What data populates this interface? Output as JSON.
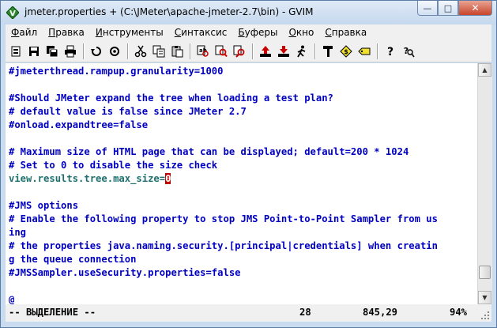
{
  "window": {
    "title": "jmeter.properties + (C:\\JMeter\\apache-jmeter-2.7\\bin) - GVIM",
    "minimize_glyph": "—",
    "maximize_glyph": "□",
    "close_glyph": "✕"
  },
  "menu": {
    "items": [
      {
        "first": "Ф",
        "rest": "айл"
      },
      {
        "first": "П",
        "rest": "равка"
      },
      {
        "first": "И",
        "rest": "нструменты"
      },
      {
        "first": "С",
        "rest": "интаксис"
      },
      {
        "first": "Б",
        "rest": "уферы"
      },
      {
        "first": "О",
        "rest": "кно"
      },
      {
        "first": "С",
        "rest": "правка"
      }
    ]
  },
  "toolbar": {
    "icons": [
      "open-icon",
      "save-icon",
      "save-all-icon",
      "print-icon",
      "undo-icon",
      "redo-icon",
      "cut-icon",
      "copy-icon",
      "paste-icon",
      "find-replace-icon",
      "find-next-icon",
      "find-prev-icon",
      "load-session-icon",
      "save-session-icon",
      "run-script-icon",
      "make-icon",
      "shell-icon",
      "tags-icon",
      "help-icon",
      "find-help-icon"
    ]
  },
  "editor": {
    "lines": [
      {
        "type": "comment",
        "text": "#jmeterthread.rampup.granularity=1000"
      },
      {
        "type": "blank",
        "text": ""
      },
      {
        "type": "comment",
        "text": "#Should JMeter expand the tree when loading a test plan?"
      },
      {
        "type": "comment",
        "text": "# default value is false since JMeter 2.7"
      },
      {
        "type": "comment",
        "text": "#onload.expandtree=false"
      },
      {
        "type": "blank",
        "text": ""
      },
      {
        "type": "comment",
        "text": "# Maximum size of HTML page that can be displayed; default=200 * 1024"
      },
      {
        "type": "comment",
        "text": "# Set to 0 to disable the size check"
      },
      {
        "type": "code",
        "key": "view.results.tree.max_size=",
        "value": "0"
      },
      {
        "type": "blank",
        "text": ""
      },
      {
        "type": "comment",
        "text": "#JMS options"
      },
      {
        "type": "comment",
        "text": "# Enable the following property to stop JMS Point-to-Point Sampler from us"
      },
      {
        "type": "comment",
        "text": "ing"
      },
      {
        "type": "comment",
        "text": "# the properties java.naming.security.[principal|credentials] when creatin"
      },
      {
        "type": "comment",
        "text": "g the queue connection"
      },
      {
        "type": "comment",
        "text": "#JMSSampler.useSecurity.properties=false"
      },
      {
        "type": "blank",
        "text": ""
      },
      {
        "type": "at",
        "text": "@"
      }
    ]
  },
  "status": {
    "mode": "-- ВЫДЕЛЕНИЕ --",
    "count": "28",
    "position": "845,29",
    "percent": "94%"
  }
}
